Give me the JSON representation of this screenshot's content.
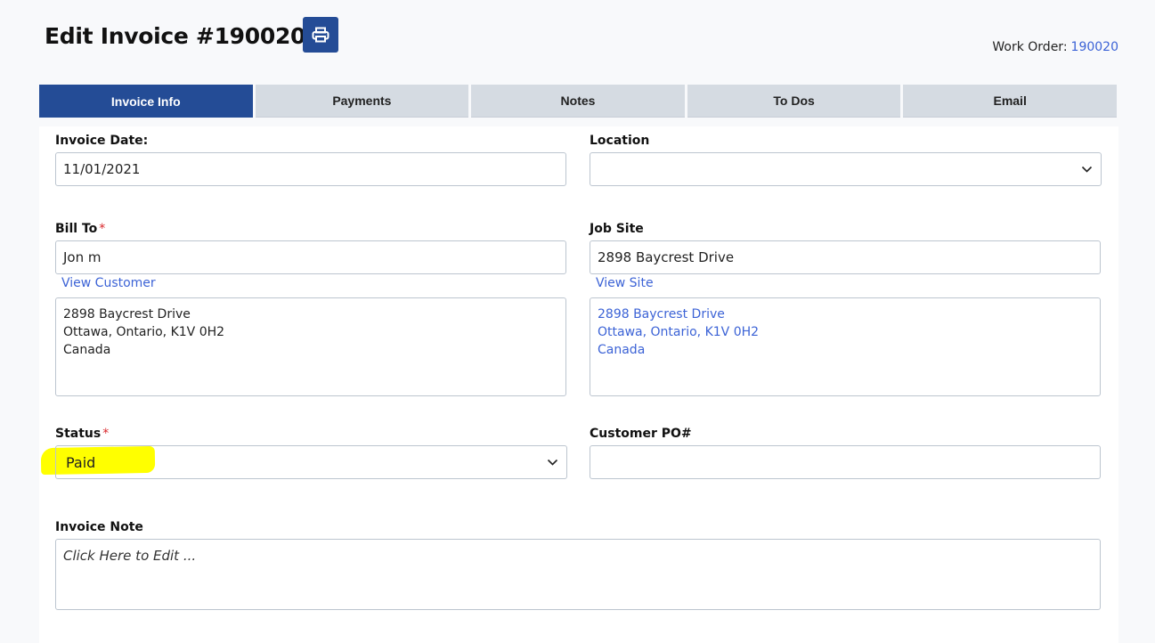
{
  "header": {
    "title": "Edit Invoice #190020-1",
    "print_icon": "printer-icon",
    "work_order_label": "Work Order:",
    "work_order_value": "190020"
  },
  "tabs": [
    {
      "label": "Invoice Info",
      "active": true
    },
    {
      "label": "Payments",
      "active": false
    },
    {
      "label": "Notes",
      "active": false
    },
    {
      "label": "To Dos",
      "active": false
    },
    {
      "label": "Email",
      "active": false
    }
  ],
  "form": {
    "invoice_date": {
      "label": "Invoice Date:",
      "value": "11/01/2021"
    },
    "location": {
      "label": "Location",
      "value": ""
    },
    "bill_to": {
      "label": "Bill To",
      "required_mark": "*",
      "value": "Jon m",
      "link": "View Customer",
      "address": [
        "2898 Baycrest Drive",
        "Ottawa, Ontario, K1V 0H2",
        "Canada"
      ]
    },
    "job_site": {
      "label": "Job Site",
      "value": "2898 Baycrest Drive",
      "link": "View Site",
      "address": [
        "2898 Baycrest Drive",
        "Ottawa, Ontario, K1V 0H2",
        "Canada"
      ]
    },
    "status": {
      "label": "Status",
      "required_mark": "*",
      "value": "Paid"
    },
    "customer_po": {
      "label": "Customer PO#",
      "value": ""
    },
    "invoice_note": {
      "label": "Invoice Note",
      "placeholder": "Click Here to Edit ..."
    }
  },
  "colors": {
    "primary": "#244c96",
    "tab_inactive": "#d5dbe2",
    "link": "#3c63d6",
    "required": "#d9262a",
    "highlight": "#ffff00"
  }
}
